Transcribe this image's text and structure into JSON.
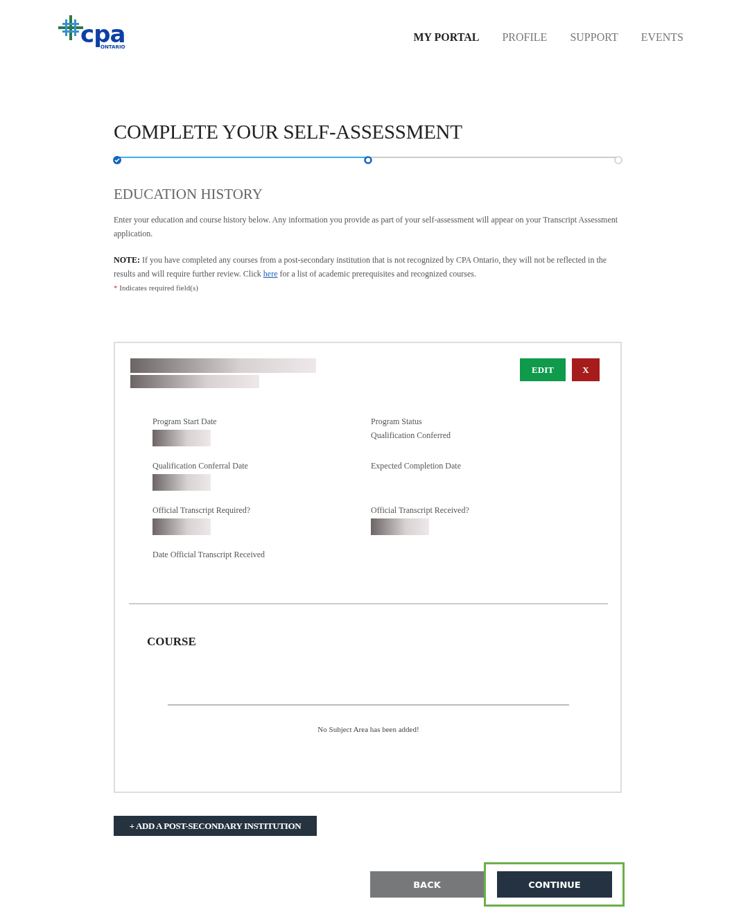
{
  "logo": {
    "mark": "cpa",
    "region": "ONTARIO"
  },
  "nav": [
    {
      "label": "MY PORTAL",
      "selected": true
    },
    {
      "label": "PROFILE",
      "selected": false
    },
    {
      "label": "SUPPORT",
      "selected": false
    },
    {
      "label": "EVENTS",
      "selected": false
    }
  ],
  "title": "COMPLETE YOUR SELF-ASSESSMENT",
  "progress": {
    "level": 0.5,
    "steps": [
      {
        "kind": "done"
      },
      {
        "kind": "current"
      },
      {
        "kind": "pending"
      }
    ]
  },
  "section_title": "EDUCATION HISTORY",
  "intro": "Enter your education and course history below. Any information you provide as part of your self-assessment will appear on your Transcript Assessment application.",
  "note": {
    "label": "NOTE:",
    "before": "If you have completed any courses from a post-secondary institution that is not recognized by CPA Ontario, they will not be reflected in the results and will require further review. Click",
    "link": "here",
    "after": "for a list of academic prerequisites and recognized courses."
  },
  "required": {
    "mark": "*",
    "text": "Indicates required field(s)"
  },
  "card": {
    "edit": "EDIT",
    "remove": "X",
    "fields": [
      {
        "label": "Program Start Date",
        "value_hidden": true
      },
      {
        "label": "Program Status",
        "value": "Qualification Conferred"
      },
      {
        "label": "Qualification Conferral Date",
        "value_hidden": true
      },
      {
        "label": "Expected Completion Date"
      },
      {
        "label": "Official Transcript Required?",
        "value_hidden": true
      },
      {
        "label": "Official Transcript Received?",
        "value_hidden": true
      },
      {
        "label": "Date Official Transcript Received"
      }
    ],
    "course_title": "COURSE",
    "empty": "No Subject Area has been added!"
  },
  "add_button": "+ ADD A POST-SECONDARY INSTITUTION",
  "back": "BACK",
  "continue": {
    "label": "CONTINUE",
    "highlighted": true
  }
}
